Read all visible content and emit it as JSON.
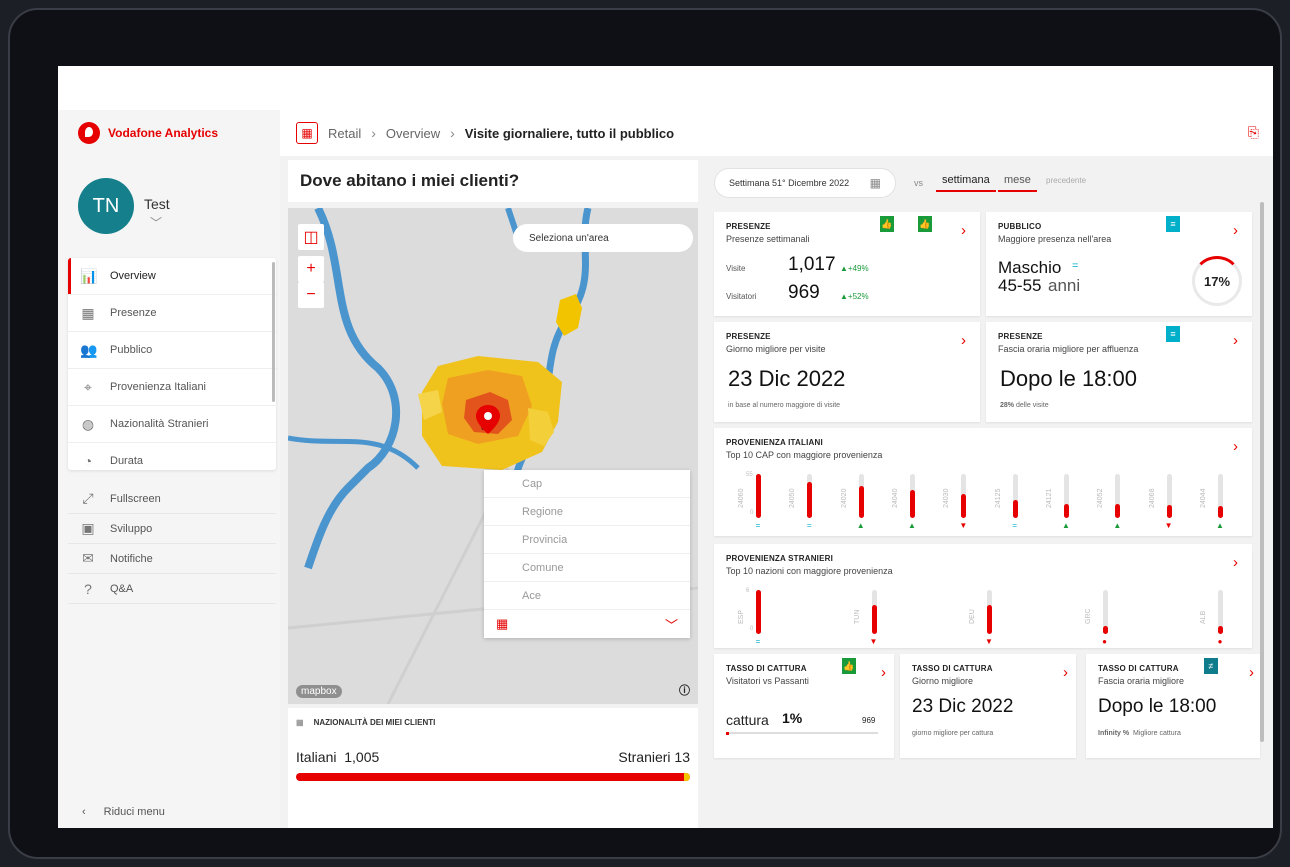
{
  "app": {
    "brand": "Vodafone Analytics"
  },
  "user": {
    "initials": "TN",
    "name": "Test"
  },
  "nav": {
    "items": [
      {
        "label": "Overview",
        "icon": "bar-chart-icon",
        "glyph": "📊"
      },
      {
        "label": "Presenze",
        "icon": "calendar-icon",
        "glyph": "▦"
      },
      {
        "label": "Pubblico",
        "icon": "people-icon",
        "glyph": "👥"
      },
      {
        "label": "Provenienza Italiani",
        "icon": "pin-route-icon",
        "glyph": "⌖"
      },
      {
        "label": "Nazionalità Stranieri",
        "icon": "globe-icon",
        "glyph": "◍"
      },
      {
        "label": "Durata",
        "icon": "clock-icon",
        "glyph": "◔"
      }
    ],
    "secondary": [
      {
        "label": "Fullscreen",
        "glyph": "⤢"
      },
      {
        "label": "Sviluppo",
        "glyph": "▣"
      },
      {
        "label": "Notifiche",
        "glyph": "✉"
      },
      {
        "label": "Q&A",
        "glyph": "?"
      }
    ],
    "collapse": "Riduci menu"
  },
  "breadcrumb": {
    "root": "Retail",
    "mid": "Overview",
    "current": "Visite giornaliere, tutto il pubblico"
  },
  "map": {
    "title": "Dove abitano i miei clienti?",
    "select_area": "Seleziona un'area",
    "layers": [
      "Cap",
      "Regione",
      "Provincia",
      "Comune",
      "Ace"
    ],
    "attribution": "mapbox"
  },
  "nationality": {
    "title": "NAZIONALITÀ DEI MIEI CLIENTI",
    "italians_label": "Italiani",
    "italians_value": "1,005",
    "foreigners_label": "Stranieri",
    "foreigners_value": "13",
    "italians_share": 0.987
  },
  "period": {
    "week": "Settimana 51° Dicembre 2022",
    "vs": "vs",
    "tab_week": "settimana",
    "tab_month": "mese",
    "tab_prev": "precedente"
  },
  "cards": {
    "presenze1": {
      "title": "PRESENZE",
      "subtitle": "Presenze settimanali",
      "visits_label": "Visite",
      "visits": "1,017",
      "visits_delta": "▲+49%",
      "visitors_label": "Visitatori",
      "visitors": "969",
      "visitors_delta": "▲+52%"
    },
    "pubblico": {
      "title": "PUBBLICO",
      "subtitle": "Maggiore presenza nell'area",
      "gender": "Maschio",
      "eq": "=",
      "age": "45-55",
      "age_unit": "anni",
      "pct": "17%"
    },
    "presenze2": {
      "title": "PRESENZE",
      "subtitle": "Giorno migliore per visite",
      "value": "23 Dic 2022",
      "note": "in base al numero maggiore di visite"
    },
    "presenze3": {
      "title": "PRESENZE",
      "subtitle": "Fascia oraria migliore per affluenza",
      "value": "Dopo le 18:00",
      "note_pct": "28%",
      "note": "delle visite"
    },
    "italiani": {
      "title": "PROVENIENZA ITALIANI",
      "subtitle": "Top 10 CAP con maggiore provenienza",
      "axis_top": "55",
      "axis_zero": "0"
    },
    "stranieri": {
      "title": "PROVENIENZA STRANIERI",
      "subtitle": "Top 10 nazioni con maggiore provenienza",
      "axis_top": "6",
      "axis_zero": "0"
    },
    "cattura1": {
      "title": "TASSO DI CATTURA",
      "subtitle": "Visitatori vs Passanti",
      "label": "cattura",
      "value": "1%",
      "count": "969"
    },
    "cattura2": {
      "title": "TASSO DI CATTURA",
      "subtitle": "Giorno migliore",
      "value": "23 Dic 2022",
      "note": "giorno migliore per cattura"
    },
    "cattura3": {
      "title": "TASSO DI CATTURA",
      "subtitle": "Fascia oraria migliore",
      "value": "Dopo le 18:00",
      "note_pct": "Infinity %",
      "note": "Migliore cattura"
    }
  },
  "cap_bars": [
    {
      "label": "24060",
      "value": 55,
      "trend": "="
    },
    {
      "label": "24050",
      "value": 45,
      "trend": "="
    },
    {
      "label": "24020",
      "value": 40,
      "trend": "▲"
    },
    {
      "label": "24040",
      "value": 35,
      "trend": "▲"
    },
    {
      "label": "24030",
      "value": 30,
      "trend": "▼"
    },
    {
      "label": "24125",
      "value": 22,
      "trend": "="
    },
    {
      "label": "24121",
      "value": 18,
      "trend": "▲"
    },
    {
      "label": "24052",
      "value": 17,
      "trend": "▲"
    },
    {
      "label": "24068",
      "value": 16,
      "trend": "▼"
    },
    {
      "label": "24044",
      "value": 15,
      "trend": "▲"
    }
  ],
  "country_bars": [
    {
      "label": "ESP",
      "value": 6,
      "trend": "="
    },
    {
      "label": "TUN",
      "value": 4,
      "trend": "▼"
    },
    {
      "label": "DEU",
      "value": 4,
      "trend": "▼"
    },
    {
      "label": "GRC",
      "value": 1,
      "trend": "●"
    },
    {
      "label": "ALB",
      "value": 1,
      "trend": "●"
    }
  ],
  "colors": {
    "brand": "#e60000",
    "up": "#1a9b3a",
    "info": "#00b0ca"
  }
}
